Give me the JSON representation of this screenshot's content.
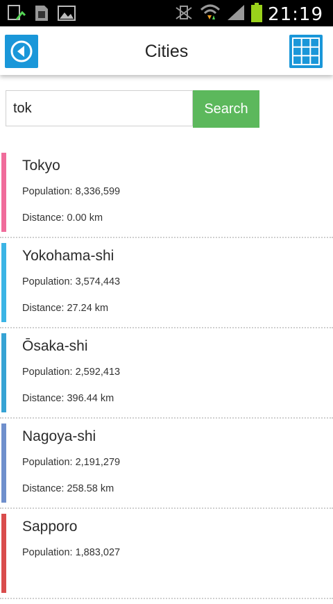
{
  "status_bar": {
    "time": "21:19"
  },
  "header": {
    "title": "Cities"
  },
  "search": {
    "value": "tok",
    "button_label": "Search"
  },
  "cities": [
    {
      "name": "Tokyo",
      "population": "Population: 8,336,599",
      "distance": "Distance: 0.00 km",
      "color": "#f06c9b"
    },
    {
      "name": "Yokohama-shi",
      "population": "Population: 3,574,443",
      "distance": "Distance: 27.24 km",
      "color": "#3bb4e5"
    },
    {
      "name": "Ōsaka-shi",
      "population": "Population: 2,592,413",
      "distance": "Distance: 396.44 km",
      "color": "#36a3d4"
    },
    {
      "name": "Nagoya-shi",
      "population": "Population: 2,191,279",
      "distance": "Distance: 258.58 km",
      "color": "#6f8fcc"
    },
    {
      "name": "Sapporo",
      "population": "Population: 1,883,027",
      "distance": "",
      "color": "#d94c4c"
    }
  ]
}
